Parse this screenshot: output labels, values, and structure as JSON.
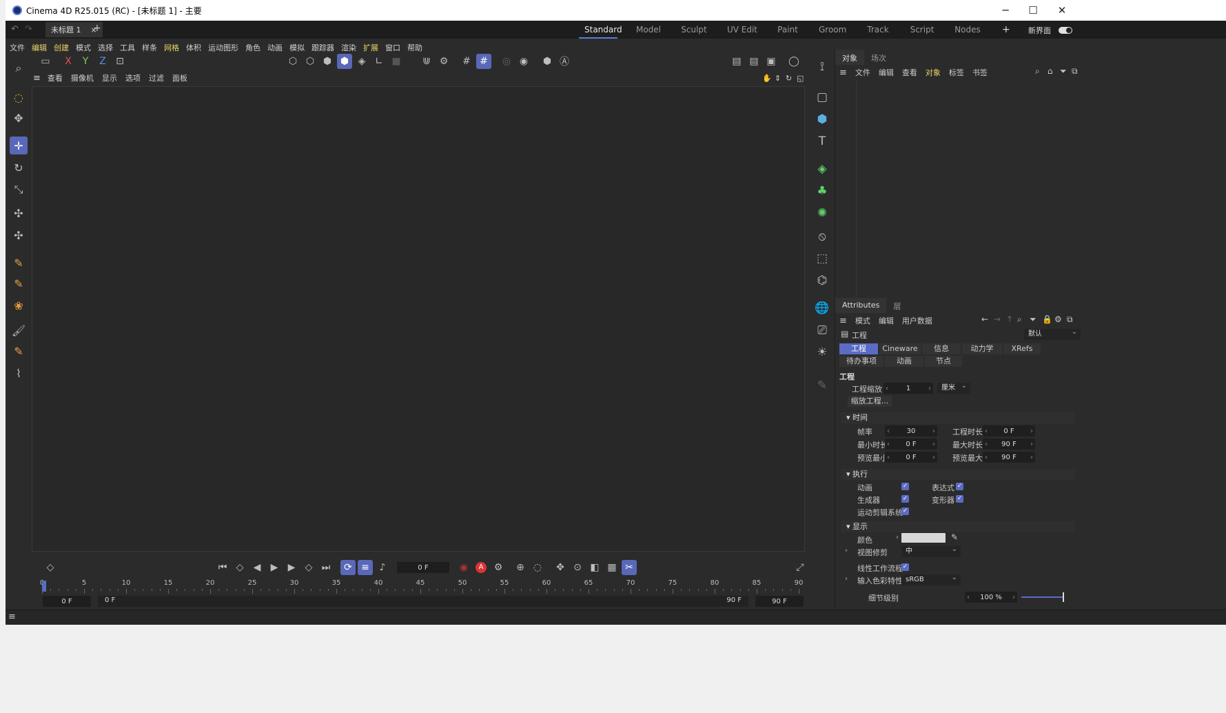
{
  "window": {
    "title": "Cinema 4D R25.015 (RC) - [未标题 1] - 主要",
    "controls": [
      "─",
      "☐",
      "✕"
    ]
  },
  "tabs": {
    "doc_tab": "未标题 1",
    "close": "×",
    "add": "+",
    "layouts": [
      "Standard",
      "Model",
      "Sculpt",
      "UV Edit",
      "Paint",
      "Groom",
      "Track",
      "Script",
      "Nodes"
    ],
    "active_layout": "Standard",
    "layout_add": "+",
    "new_ui": "新界面"
  },
  "menu": [
    "文件",
    "编辑",
    "创建",
    "模式",
    "选择",
    "工具",
    "样条",
    "网格",
    "体积",
    "运动图形",
    "角色",
    "动画",
    "模拟",
    "跟踪器",
    "渲染",
    "扩展",
    "窗口",
    "帮助"
  ],
  "menu_highlighted": [
    "编辑",
    "网格",
    "扩展"
  ],
  "axis_buttons": {
    "x": "X",
    "y": "Y",
    "z": "Z"
  },
  "viewport_menu": [
    "查看",
    "摄像机",
    "显示",
    "选项",
    "过滤",
    "面板"
  ],
  "timeline": {
    "current_frame": "0 F",
    "start_field": "0 F",
    "start_field2": "0 F",
    "end_field": "90 F",
    "end_field2": "90 F",
    "ticks": [
      "0",
      "5",
      "10",
      "15",
      "20",
      "25",
      "30",
      "35",
      "40",
      "45",
      "50",
      "55",
      "60",
      "65",
      "70",
      "75",
      "80",
      "85",
      "90"
    ],
    "record_label": "A"
  },
  "object_manager": {
    "tabs": [
      "对象",
      "场次"
    ],
    "menu": [
      "文件",
      "编辑",
      "查看",
      "对象",
      "标签",
      "书签"
    ],
    "menu_highlighted": "对象"
  },
  "attributes": {
    "tabs": [
      "Attributes",
      "层"
    ],
    "menu": [
      "模式",
      "编辑",
      "用户数据"
    ],
    "header_label": "工程",
    "preset": "默认",
    "tab_row1": [
      "工程",
      "Cineware",
      "信息",
      "动力学",
      "XRefs"
    ],
    "tab_row2": [
      "待办事项",
      "动画",
      "节点"
    ],
    "section_title": "工程",
    "scale_label": "工程缩放",
    "scale_value": "1",
    "scale_unit": "厘米",
    "scale_button": "缩放工程...",
    "time_section": "时间",
    "fps_label": "帧率",
    "fps_value": "30",
    "proj_len_label": "工程时长",
    "proj_len_value": "0 F",
    "min_label": "最小时长",
    "min_value": "0 F",
    "max_label": "最大时长",
    "max_value": "90 F",
    "prev_min_label": "预览最小",
    "prev_min_value": "0 F",
    "prev_max_label": "预览最大",
    "prev_max_value": "90 F",
    "exec_section": "执行",
    "anim_label": "动画",
    "expr_label": "表达式",
    "gen_label": "生成器",
    "deform_label": "变形器",
    "motion_label": "运动剪辑系统",
    "display_section": "显示",
    "color_label": "颜色",
    "clip_label": "视图修剪",
    "clip_value": "中",
    "linear_label": "线性工作流程",
    "input_color_label": "输入色彩特性",
    "input_color_value": "sRGB",
    "lod_label": "细节级别",
    "lod_value": "100 %"
  },
  "colors": {
    "accent": "#5a6cc4",
    "highlight_text": "#e8d46a",
    "bg": "#2b2b2b"
  }
}
